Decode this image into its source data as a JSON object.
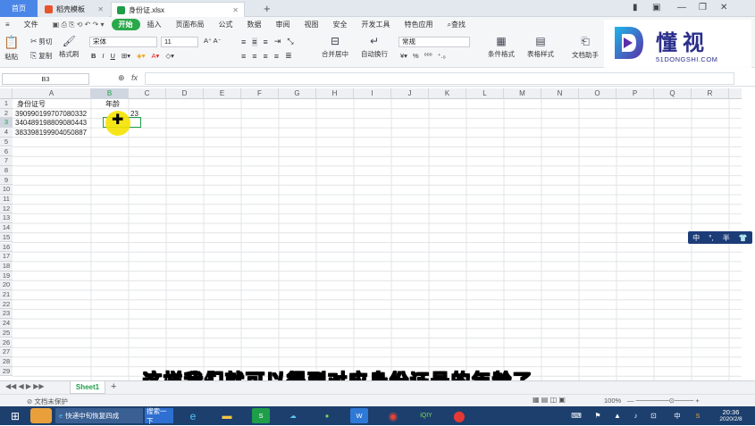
{
  "tabs": {
    "home": "首页",
    "t1": "稻壳模板",
    "t2": "身份证.xlsx",
    "plus": "+"
  },
  "menu": [
    "文件",
    "开始",
    "插入",
    "页面布局",
    "公式",
    "数据",
    "审阅",
    "视图",
    "安全",
    "开发工具",
    "特色应用",
    "查找"
  ],
  "ribbon": {
    "paste": "粘贴",
    "cut": "剪切",
    "copy": "复制",
    "format_painter": "格式刷",
    "font": "宋体",
    "size": "11",
    "bold": "B",
    "italic": "I",
    "underline": "U",
    "merge": "合并居中",
    "wrap": "自动换行",
    "num_format": "常规",
    "cond_format": "条件格式",
    "table_style": "表格样式",
    "doc_helper": "文档助手"
  },
  "logo": {
    "cn": "懂视",
    "en": "51DONGSHI.COM"
  },
  "formula_bar": {
    "name_box": "B3",
    "fx": "fx"
  },
  "columns": [
    "A",
    "B",
    "C",
    "D",
    "E",
    "F",
    "G",
    "H",
    "I",
    "J",
    "K",
    "L",
    "M",
    "N",
    "O",
    "P",
    "Q",
    "R"
  ],
  "rows": [
    "1",
    "2",
    "3",
    "4",
    "5",
    "6",
    "7",
    "8",
    "9",
    "10",
    "11",
    "12",
    "13",
    "14",
    "15",
    "16",
    "17",
    "18",
    "19",
    "20",
    "21",
    "22",
    "23",
    "24",
    "25",
    "26",
    "27",
    "28",
    "29"
  ],
  "cells": {
    "A1": "身份证号",
    "B1": "年龄",
    "A2": "390990199707080332",
    "B2": "23",
    "A3": "340489198809080443",
    "A4": "383398199904050887"
  },
  "sheet": {
    "name": "Sheet1",
    "add": "+"
  },
  "status": {
    "protect": "文档未保护",
    "zoom": "100%"
  },
  "subtitle": "这样我们就可以得到对应身份证号的年龄了",
  "ime": {
    "lang": "中",
    "punct": "°,",
    "width": "半"
  },
  "taskbar": {
    "task1": "快递中旬恢复四成",
    "task2": "搜索一下",
    "clock_time": "20:36",
    "clock_date": "2020/2/8",
    "ime": "中"
  },
  "colors": {
    "accent": "#2aa84a",
    "home_tab": "#4a86e8",
    "taskbar": "#1d3f6e",
    "logo": "#2a2f8a",
    "highlight": "#f5e300"
  }
}
